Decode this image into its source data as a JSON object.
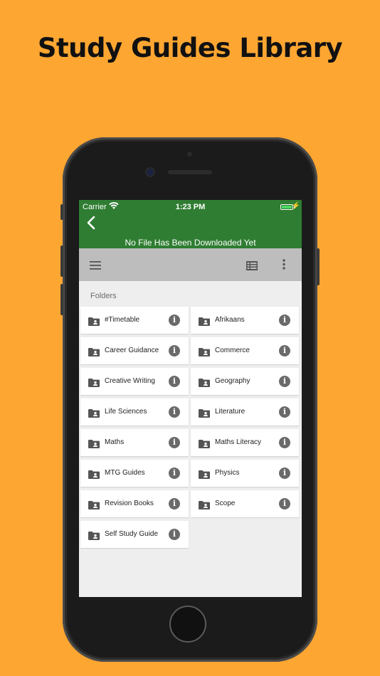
{
  "promo": {
    "title": "Study Guides Library"
  },
  "status_bar": {
    "carrier": "Carrier",
    "time": "1:23 PM"
  },
  "app_bar": {
    "message": "No File Has Been Downloaded Yet"
  },
  "folders_section": {
    "label": "Folders"
  },
  "folders": [
    {
      "name": "#Timetable"
    },
    {
      "name": "Afrikaans"
    },
    {
      "name": "Career Guidance"
    },
    {
      "name": "Commerce"
    },
    {
      "name": "Creative Writing"
    },
    {
      "name": "Geography"
    },
    {
      "name": "Life Sciences"
    },
    {
      "name": "Literature"
    },
    {
      "name": "Maths"
    },
    {
      "name": "Maths Literacy"
    },
    {
      "name": "MTG Guides"
    },
    {
      "name": "Physics"
    },
    {
      "name": "Revision Books"
    },
    {
      "name": "Scope"
    },
    {
      "name": "Self Study Guide"
    }
  ],
  "icons": {
    "back": "chevron-left-icon",
    "menu": "hamburger-menu-icon",
    "view": "list-view-icon",
    "more": "more-vert-icon",
    "folder": "shared-folder-icon",
    "info": "info-icon"
  },
  "colors": {
    "background": "#fda632",
    "app_bar": "#2f7d32",
    "toolbar": "#bdbdbd",
    "battery": "#4cd964"
  }
}
